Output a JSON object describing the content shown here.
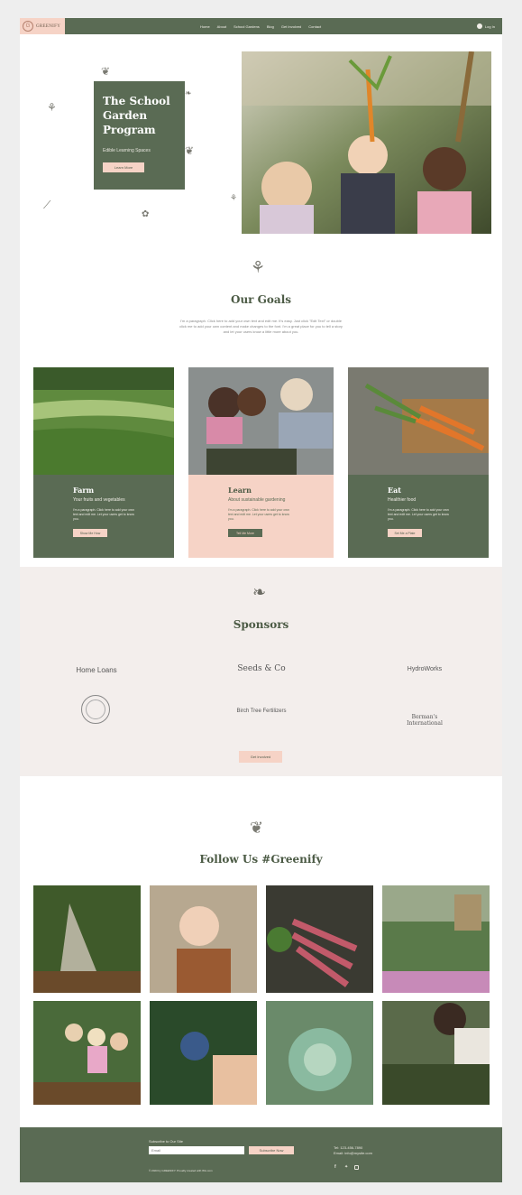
{
  "brand": {
    "logo_text": "GREENIFY",
    "logo_mark": "G"
  },
  "nav": [
    "Home",
    "About",
    "School Gardens",
    "Blog",
    "Get Involved",
    "Contact"
  ],
  "login_label": "Log In",
  "hero": {
    "title": "The School Garden Program",
    "subtitle": "Edible Learning Spaces",
    "button": "Learn More"
  },
  "goals": {
    "title": "Our Goals",
    "paragraph": "I'm a paragraph. Click here to add your own text and edit me. It's easy. Just click \"Edit Text\" or double click me to add your own content and make changes to the font. I'm a great place for you to tell a story and let your users know a little more about you."
  },
  "cards": [
    {
      "title": "Farm",
      "subtitle": "Your fruits and vegetables",
      "body": "I'm a paragraph. Click here to add your own text and edit me. Let your users get to know you.",
      "button": "Show Me How"
    },
    {
      "title": "Learn",
      "subtitle": "About sustainable gardening",
      "body": "I'm a paragraph. Click here to add your own text and edit me. Let your users get to know you.",
      "button": "Tell Me More"
    },
    {
      "title": "Eat",
      "subtitle": "Healthier food",
      "body": "I'm a paragraph. Click here to add your own text and edit me. Let your users get to know you.",
      "button": "Set Me a Plate"
    }
  ],
  "sponsors": {
    "title": "Sponsors",
    "logos": [
      "Home Loans",
      "Seeds & Co",
      "HydroWorks",
      "Birch Tree Fertilizers",
      "Berman's International"
    ],
    "button": "Get Involved"
  },
  "follow": {
    "title": "Follow Us #Greenify"
  },
  "footer": {
    "subscribe_label": "Subscribe to Our Site",
    "email_placeholder": "Email",
    "subscribe_button": "Subscribe Now",
    "phone": "Tel: 123-456-7890",
    "email": "Email: info@mysite.com",
    "copyright": "© 2023 by GREENIFY. Proudly created with Wix.com"
  },
  "colors": {
    "primary": "#5a6b54",
    "accent": "#f6d3c6",
    "sponsors_bg": "#f3eeec"
  },
  "icons": [
    "user-icon",
    "sprout-icon",
    "peas-icon",
    "artichoke-icon",
    "facebook-icon",
    "twitter-icon",
    "instagram-icon"
  ]
}
